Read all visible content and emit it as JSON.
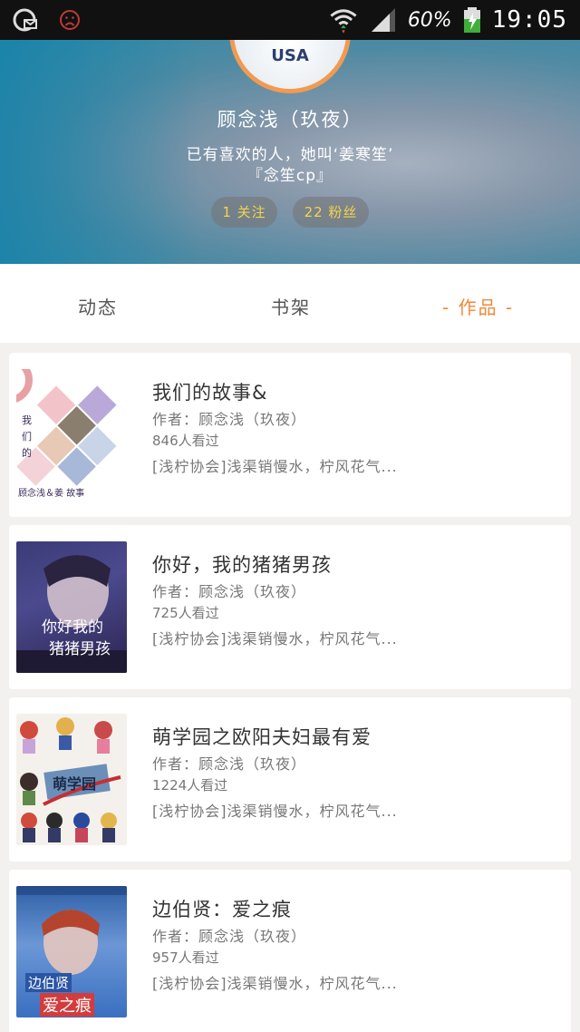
{
  "status_bar": {
    "battery": "60%",
    "time": "19:05"
  },
  "profile": {
    "avatar_text": "USA",
    "name": "顾念浅（玖夜）",
    "bio_line1": "已有喜欢的人，她叫‘姜寒笙’",
    "bio_line2": "『念笙cp』",
    "following": "1 关注",
    "fans": "22 粉丝"
  },
  "tabs": {
    "dynamic": "动态",
    "shelf": "书架",
    "works": "- 作品 -"
  },
  "works": [
    {
      "title": "我们的故事&",
      "author": "作者：顾念浅（玖夜）",
      "views": "846人看过",
      "tags": "[浅柠协会]浅渠销慢水，柠风花气...",
      "cover_text_top": "我们的",
      "cover_text_bottom": "顾念浅＆姜 故事"
    },
    {
      "title": "你好，我的猪猪男孩",
      "author": "作者：顾念浅（玖夜）",
      "views": "725人看过",
      "tags": "[浅柠协会]浅渠销慢水，柠风花气...",
      "cover_text_top": "你好我的",
      "cover_text_bottom": "猪猪男孩"
    },
    {
      "title": "萌学园之欧阳夫妇最有爱",
      "author": "作者：顾念浅（玖夜）",
      "views": "1224人看过",
      "tags": "[浅柠协会]浅渠销慢水，柠风花气...",
      "cover_text_top": "萌学园",
      "cover_text_bottom": ""
    },
    {
      "title": "边伯贤：爱之痕",
      "author": "作者：顾念浅（玖夜）",
      "views": "957人看过",
      "tags": "[浅柠协会]浅渠销慢水，柠风花气...",
      "cover_text_top": "边伯贤",
      "cover_text_bottom": "爱之痕"
    }
  ],
  "colors": {
    "accent": "#f0883a",
    "pill_text": "#f5d44b",
    "avatar_border": "#f29a52"
  }
}
